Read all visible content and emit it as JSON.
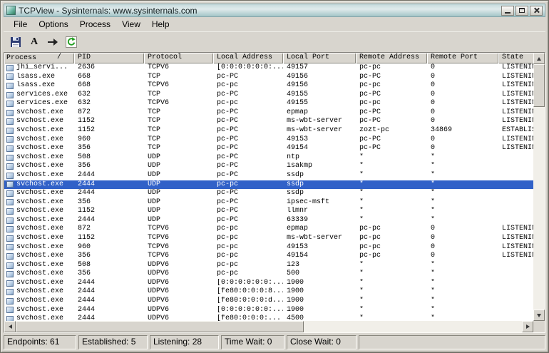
{
  "window": {
    "title": "TCPView - Sysinternals: www.sysinternals.com",
    "controls": [
      "minimize",
      "maximize",
      "close"
    ]
  },
  "menu": {
    "items": [
      "File",
      "Options",
      "Process",
      "View",
      "Help"
    ]
  },
  "toolbar": {
    "buttons": [
      "save",
      "font",
      "disconnect",
      "refresh"
    ],
    "font_label": "A"
  },
  "table": {
    "sort_indicator": "/",
    "columns": [
      {
        "key": "process",
        "label": "Process"
      },
      {
        "key": "pid",
        "label": "PID"
      },
      {
        "key": "protocol",
        "label": "Protocol"
      },
      {
        "key": "local_address",
        "label": "Local Address"
      },
      {
        "key": "local_port",
        "label": "Local Port"
      },
      {
        "key": "remote_address",
        "label": "Remote Address"
      },
      {
        "key": "remote_port",
        "label": "Remote Port"
      },
      {
        "key": "state",
        "label": "State"
      }
    ],
    "rows": [
      {
        "process": "jhi_servi...",
        "pid": "2636",
        "protocol": "TCPV6",
        "local_address": "[0:0:0:0:0:0:...",
        "local_port": "49157",
        "remote_address": "pc-pc",
        "remote_port": "0",
        "state": "LISTENING",
        "selected": false
      },
      {
        "process": "lsass.exe",
        "pid": "668",
        "protocol": "TCP",
        "local_address": "pc-PC",
        "local_port": "49156",
        "remote_address": "pc-PC",
        "remote_port": "0",
        "state": "LISTENING",
        "selected": false
      },
      {
        "process": "lsass.exe",
        "pid": "668",
        "protocol": "TCPV6",
        "local_address": "pc-pc",
        "local_port": "49156",
        "remote_address": "pc-pc",
        "remote_port": "0",
        "state": "LISTENING",
        "selected": false
      },
      {
        "process": "services.exe",
        "pid": "632",
        "protocol": "TCP",
        "local_address": "pc-PC",
        "local_port": "49155",
        "remote_address": "pc-PC",
        "remote_port": "0",
        "state": "LISTENING",
        "selected": false
      },
      {
        "process": "services.exe",
        "pid": "632",
        "protocol": "TCPV6",
        "local_address": "pc-pc",
        "local_port": "49155",
        "remote_address": "pc-pc",
        "remote_port": "0",
        "state": "LISTENING",
        "selected": false
      },
      {
        "process": "svchost.exe",
        "pid": "872",
        "protocol": "TCP",
        "local_address": "pc-PC",
        "local_port": "epmap",
        "remote_address": "pc-PC",
        "remote_port": "0",
        "state": "LISTENING",
        "selected": false
      },
      {
        "process": "svchost.exe",
        "pid": "1152",
        "protocol": "TCP",
        "local_address": "pc-PC",
        "local_port": "ms-wbt-server",
        "remote_address": "pc-PC",
        "remote_port": "0",
        "state": "LISTENING",
        "selected": false
      },
      {
        "process": "svchost.exe",
        "pid": "1152",
        "protocol": "TCP",
        "local_address": "pc-PC",
        "local_port": "ms-wbt-server",
        "remote_address": "zozt-pc",
        "remote_port": "34869",
        "state": "ESTABLISHED",
        "selected": false
      },
      {
        "process": "svchost.exe",
        "pid": "960",
        "protocol": "TCP",
        "local_address": "pc-PC",
        "local_port": "49153",
        "remote_address": "pc-PC",
        "remote_port": "0",
        "state": "LISTENING",
        "selected": false
      },
      {
        "process": "svchost.exe",
        "pid": "356",
        "protocol": "TCP",
        "local_address": "pc-PC",
        "local_port": "49154",
        "remote_address": "pc-PC",
        "remote_port": "0",
        "state": "LISTENING",
        "selected": false
      },
      {
        "process": "svchost.exe",
        "pid": "508",
        "protocol": "UDP",
        "local_address": "pc-PC",
        "local_port": "ntp",
        "remote_address": "*",
        "remote_port": "*",
        "state": "",
        "selected": false
      },
      {
        "process": "svchost.exe",
        "pid": "356",
        "protocol": "UDP",
        "local_address": "pc-PC",
        "local_port": "isakmp",
        "remote_address": "*",
        "remote_port": "*",
        "state": "",
        "selected": false
      },
      {
        "process": "svchost.exe",
        "pid": "2444",
        "protocol": "UDP",
        "local_address": "pc-PC",
        "local_port": "ssdp",
        "remote_address": "*",
        "remote_port": "*",
        "state": "",
        "selected": false
      },
      {
        "process": "svchost.exe",
        "pid": "2444",
        "protocol": "UDP",
        "local_address": "pc-pc",
        "local_port": "ssdp",
        "remote_address": "*",
        "remote_port": "*",
        "state": "",
        "selected": true
      },
      {
        "process": "svchost.exe",
        "pid": "2444",
        "protocol": "UDP",
        "local_address": "pc-PC",
        "local_port": "ssdp",
        "remote_address": "*",
        "remote_port": "*",
        "state": "",
        "selected": false
      },
      {
        "process": "svchost.exe",
        "pid": "356",
        "protocol": "UDP",
        "local_address": "pc-PC",
        "local_port": "ipsec-msft",
        "remote_address": "*",
        "remote_port": "*",
        "state": "",
        "selected": false
      },
      {
        "process": "svchost.exe",
        "pid": "1152",
        "protocol": "UDP",
        "local_address": "pc-PC",
        "local_port": "llmnr",
        "remote_address": "*",
        "remote_port": "*",
        "state": "",
        "selected": false
      },
      {
        "process": "svchost.exe",
        "pid": "2444",
        "protocol": "UDP",
        "local_address": "pc-PC",
        "local_port": "63339",
        "remote_address": "*",
        "remote_port": "*",
        "state": "",
        "selected": false
      },
      {
        "process": "svchost.exe",
        "pid": "872",
        "protocol": "TCPV6",
        "local_address": "pc-pc",
        "local_port": "epmap",
        "remote_address": "pc-pc",
        "remote_port": "0",
        "state": "LISTENING",
        "selected": false
      },
      {
        "process": "svchost.exe",
        "pid": "1152",
        "protocol": "TCPV6",
        "local_address": "pc-pc",
        "local_port": "ms-wbt-server",
        "remote_address": "pc-pc",
        "remote_port": "0",
        "state": "LISTENING",
        "selected": false
      },
      {
        "process": "svchost.exe",
        "pid": "960",
        "protocol": "TCPV6",
        "local_address": "pc-pc",
        "local_port": "49153",
        "remote_address": "pc-pc",
        "remote_port": "0",
        "state": "LISTENING",
        "selected": false
      },
      {
        "process": "svchost.exe",
        "pid": "356",
        "protocol": "TCPV6",
        "local_address": "pc-pc",
        "local_port": "49154",
        "remote_address": "pc-pc",
        "remote_port": "0",
        "state": "LISTENING",
        "selected": false
      },
      {
        "process": "svchost.exe",
        "pid": "508",
        "protocol": "UDPV6",
        "local_address": "pc-pc",
        "local_port": "123",
        "remote_address": "*",
        "remote_port": "*",
        "state": "",
        "selected": false
      },
      {
        "process": "svchost.exe",
        "pid": "356",
        "protocol": "UDPV6",
        "local_address": "pc-pc",
        "local_port": "500",
        "remote_address": "*",
        "remote_port": "*",
        "state": "",
        "selected": false
      },
      {
        "process": "svchost.exe",
        "pid": "2444",
        "protocol": "UDPV6",
        "local_address": "[0:0:0:0:0:0:...",
        "local_port": "1900",
        "remote_address": "*",
        "remote_port": "*",
        "state": "",
        "selected": false
      },
      {
        "process": "svchost.exe",
        "pid": "2444",
        "protocol": "UDPV6",
        "local_address": "[fe80:0:0:0:8...",
        "local_port": "1900",
        "remote_address": "*",
        "remote_port": "*",
        "state": "",
        "selected": false
      },
      {
        "process": "svchost.exe",
        "pid": "2444",
        "protocol": "UDPV6",
        "local_address": "[fe80:0:0:0:d...",
        "local_port": "1900",
        "remote_address": "*",
        "remote_port": "*",
        "state": "",
        "selected": false
      },
      {
        "process": "svchost.exe",
        "pid": "2444",
        "protocol": "UDPV6",
        "local_address": "[0:0:0:0:0:0:...",
        "local_port": "1900",
        "remote_address": "*",
        "remote_port": "*",
        "state": "",
        "selected": false
      },
      {
        "process": "svchost.exe",
        "pid": "2444",
        "protocol": "UDPV6",
        "local_address": "[fe80:0:0:0:...",
        "local_port": "4500",
        "remote_address": "*",
        "remote_port": "*",
        "state": "",
        "selected": false
      }
    ]
  },
  "statusbar": {
    "sections": [
      "Endpoints: 61",
      "Established: 5",
      "Listening: 28",
      "Time Wait: 0",
      "Close Wait: 0"
    ]
  },
  "colors": {
    "selection": "#3161c8"
  }
}
